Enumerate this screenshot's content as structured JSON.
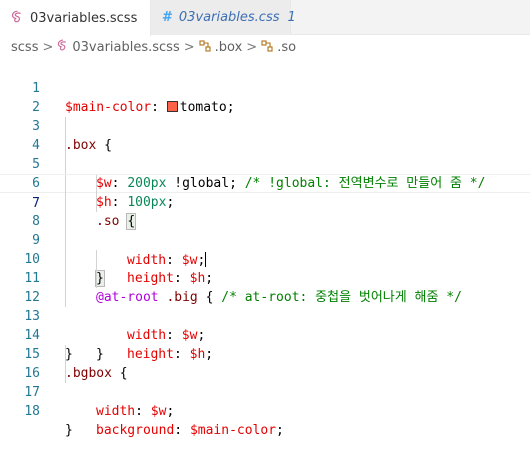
{
  "tabs": [
    {
      "label": "03variables.scss",
      "icon": "sass-icon",
      "close": "×"
    },
    {
      "label": "03variables.css",
      "icon": "css-icon",
      "icon_glyph": "#",
      "badge": "1"
    }
  ],
  "breadcrumb": {
    "items": [
      "scss",
      "03variables.scss",
      ".box",
      ".so"
    ],
    "separator": ">"
  },
  "colors": {
    "swatch": "#ff6347"
  },
  "editor": {
    "current_line": 7,
    "lines": [
      {
        "n": "1"
      },
      {
        "n": "2"
      },
      {
        "n": "3"
      },
      {
        "n": "4"
      },
      {
        "n": "5"
      },
      {
        "n": "6"
      },
      {
        "n": "7"
      },
      {
        "n": "8"
      },
      {
        "n": "9"
      },
      {
        "n": "10"
      },
      {
        "n": "11"
      },
      {
        "n": "12"
      },
      {
        "n": "13"
      },
      {
        "n": "14"
      },
      {
        "n": "15"
      },
      {
        "n": "16"
      },
      {
        "n": "17"
      },
      {
        "n": "18"
      }
    ],
    "tokens": {
      "l1_var": "$main-color",
      "l1_colon": ":",
      "l1_val": "tomato",
      "l1_semi": ";",
      "l3_sel": ".box",
      "l3_brace": " {",
      "l4_var": "$w",
      "l4_colon": ": ",
      "l4_num": "200px",
      "l4_flag": " !global; ",
      "l4_com": "/* !global: 전역변수로 만들어 줌 */",
      "l5_var": "$h",
      "l5_colon": ": ",
      "l5_num": "100px",
      "l5_semi": ";",
      "l6_sel": ".so",
      "l6_sp": " ",
      "l6_brace": "{",
      "l7_prop": "width",
      "l7_colon": ": ",
      "l7_var": "$w",
      "l7_semi": ";",
      "l8_prop": "height",
      "l8_colon": ": ",
      "l8_var": "$h",
      "l8_semi": ";",
      "l9_brace": "}",
      "l10_kw": "@at-root",
      "l10_sel": " .big",
      "l10_brace": " { ",
      "l10_com": "/* at-root: 중첩을 벗어나게 해줌 */",
      "l11_prop": "width",
      "l11_colon": ": ",
      "l11_var": "$w",
      "l11_semi": ";",
      "l12_prop": "height",
      "l12_colon": ": ",
      "l12_var": "$h",
      "l12_semi": ";",
      "l13_brace": "}",
      "l14_brace": "}",
      "l15_sel": ".bgbox",
      "l15_brace": " {",
      "l16_prop": "width",
      "l16_colon": ": ",
      "l16_var": "$w",
      "l16_semi": ";",
      "l17_prop": "background",
      "l17_colon": ": ",
      "l17_var": "$main-color",
      "l17_semi": ";",
      "l18_brace": "}"
    }
  }
}
